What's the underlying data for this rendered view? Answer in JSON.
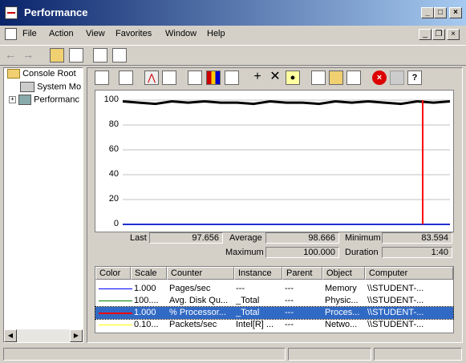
{
  "window": {
    "title": "Performance"
  },
  "menu": [
    "File",
    "Action",
    "View",
    "Favorites",
    "Window",
    "Help"
  ],
  "tree": {
    "items": [
      "Console Root",
      "System Mo",
      "Performanc"
    ]
  },
  "chart_data": {
    "type": "line",
    "ylim": [
      0,
      100
    ],
    "yticks": [
      "100",
      "80",
      "60",
      "40",
      "20",
      "0"
    ],
    "x": [
      0,
      5,
      10,
      15,
      20,
      25,
      30,
      35,
      40,
      45,
      50,
      55,
      60,
      65,
      70,
      75,
      80,
      85,
      90,
      95,
      100
    ],
    "series": [
      {
        "name": "% Processor...",
        "color": "#000000",
        "values": [
          99,
          98,
          97,
          99,
          98,
          99,
          98,
          98,
          97,
          99,
          98,
          98,
          97,
          99,
          98,
          99,
          98,
          97,
          99,
          98,
          99
        ]
      },
      {
        "name": "Pages/sec",
        "color": "#0000ff",
        "values": [
          0,
          0,
          0,
          0,
          0,
          0,
          0,
          0,
          0,
          0,
          0,
          0,
          0,
          0,
          0,
          0,
          0,
          0,
          0,
          0,
          0
        ]
      },
      {
        "name": "Avg. Disk Qu...",
        "color": "#008000",
        "values": [
          0,
          0,
          0,
          0,
          0,
          0,
          0,
          0,
          0,
          0,
          0,
          0,
          0,
          0,
          0,
          0,
          0,
          0,
          0,
          0,
          0
        ]
      },
      {
        "name": "Packets/sec",
        "color": "#ffff00",
        "values": [
          0,
          0,
          0,
          0,
          0,
          0,
          0,
          0,
          0,
          0,
          0,
          0,
          0,
          0,
          0,
          0,
          0,
          0,
          0,
          0,
          0
        ]
      }
    ]
  },
  "stats": {
    "last_label": "Last",
    "last": "97.656",
    "average_label": "Average",
    "average": "98.666",
    "minimum_label": "Minimum",
    "minimum": "83.594",
    "maximum_label": "Maximum",
    "maximum": "100.000",
    "duration_label": "Duration",
    "duration": "1:40"
  },
  "legend": {
    "headers": [
      "Color",
      "Scale",
      "Counter",
      "Instance",
      "Parent",
      "Object",
      "Computer"
    ],
    "rows": [
      {
        "color": "#0000ff",
        "scale": "1.000",
        "counter": "Pages/sec",
        "instance": "---",
        "parent": "---",
        "object": "Memory",
        "computer": "\\\\STUDENT-..."
      },
      {
        "color": "#008000",
        "scale": "100....",
        "counter": "Avg. Disk Qu...",
        "instance": "_Total",
        "parent": "---",
        "object": "Physic...",
        "computer": "\\\\STUDENT-..."
      },
      {
        "color": "#ff0000",
        "scale": "1.000",
        "counter": "% Processor...",
        "instance": "_Total",
        "parent": "---",
        "object": "Proces...",
        "computer": "\\\\STUDENT-..."
      },
      {
        "color": "#ffff00",
        "scale": "0.10...",
        "counter": "Packets/sec",
        "instance": "Intel[R] ...",
        "parent": "---",
        "object": "Netwo...",
        "computer": "\\\\STUDENT-..."
      }
    ]
  }
}
